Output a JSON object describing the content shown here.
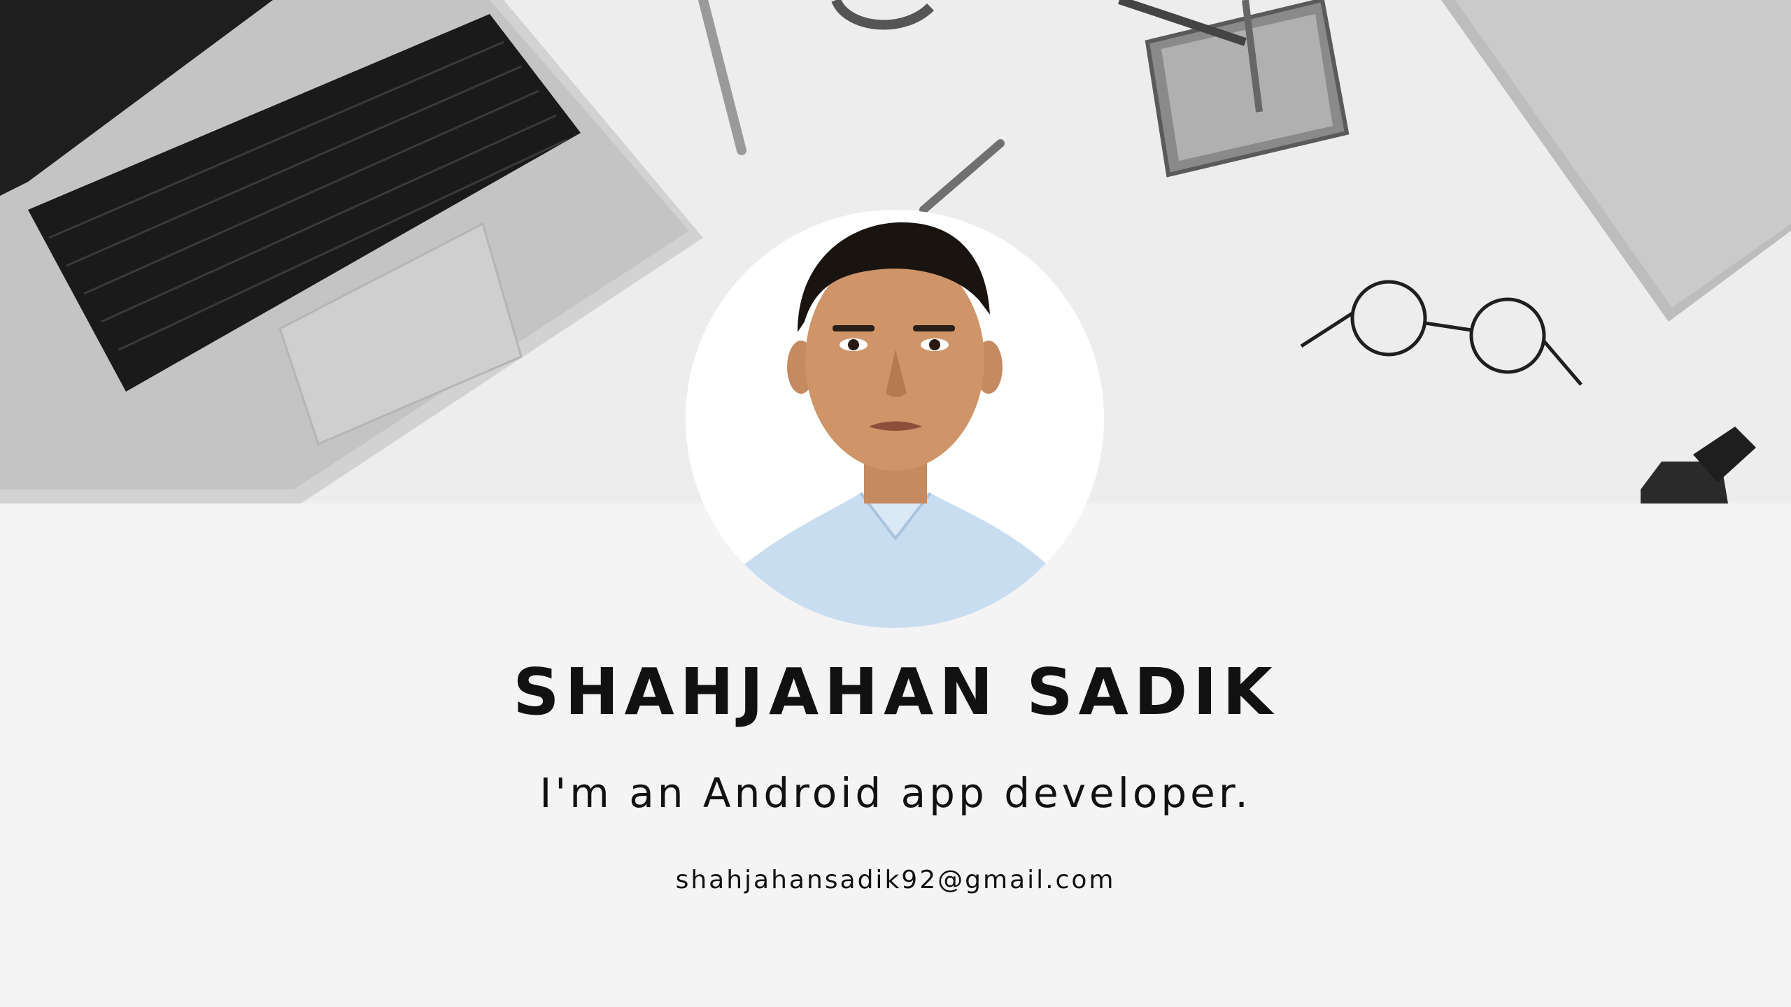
{
  "profile": {
    "name": "SHAHJAHAN SADIK",
    "tagline": "I'm an Android app developer.",
    "email": "shahjahansadik92@gmail.com"
  },
  "colors": {
    "page_background": "#f4f4f4",
    "banner_background": "#eeeeee",
    "text": "#111111"
  },
  "banner": {
    "icons": [
      "laptop-icon",
      "pen-icon",
      "pencil-holder-icon",
      "glasses-icon",
      "notebook-icon",
      "smartwatch-icon"
    ]
  }
}
